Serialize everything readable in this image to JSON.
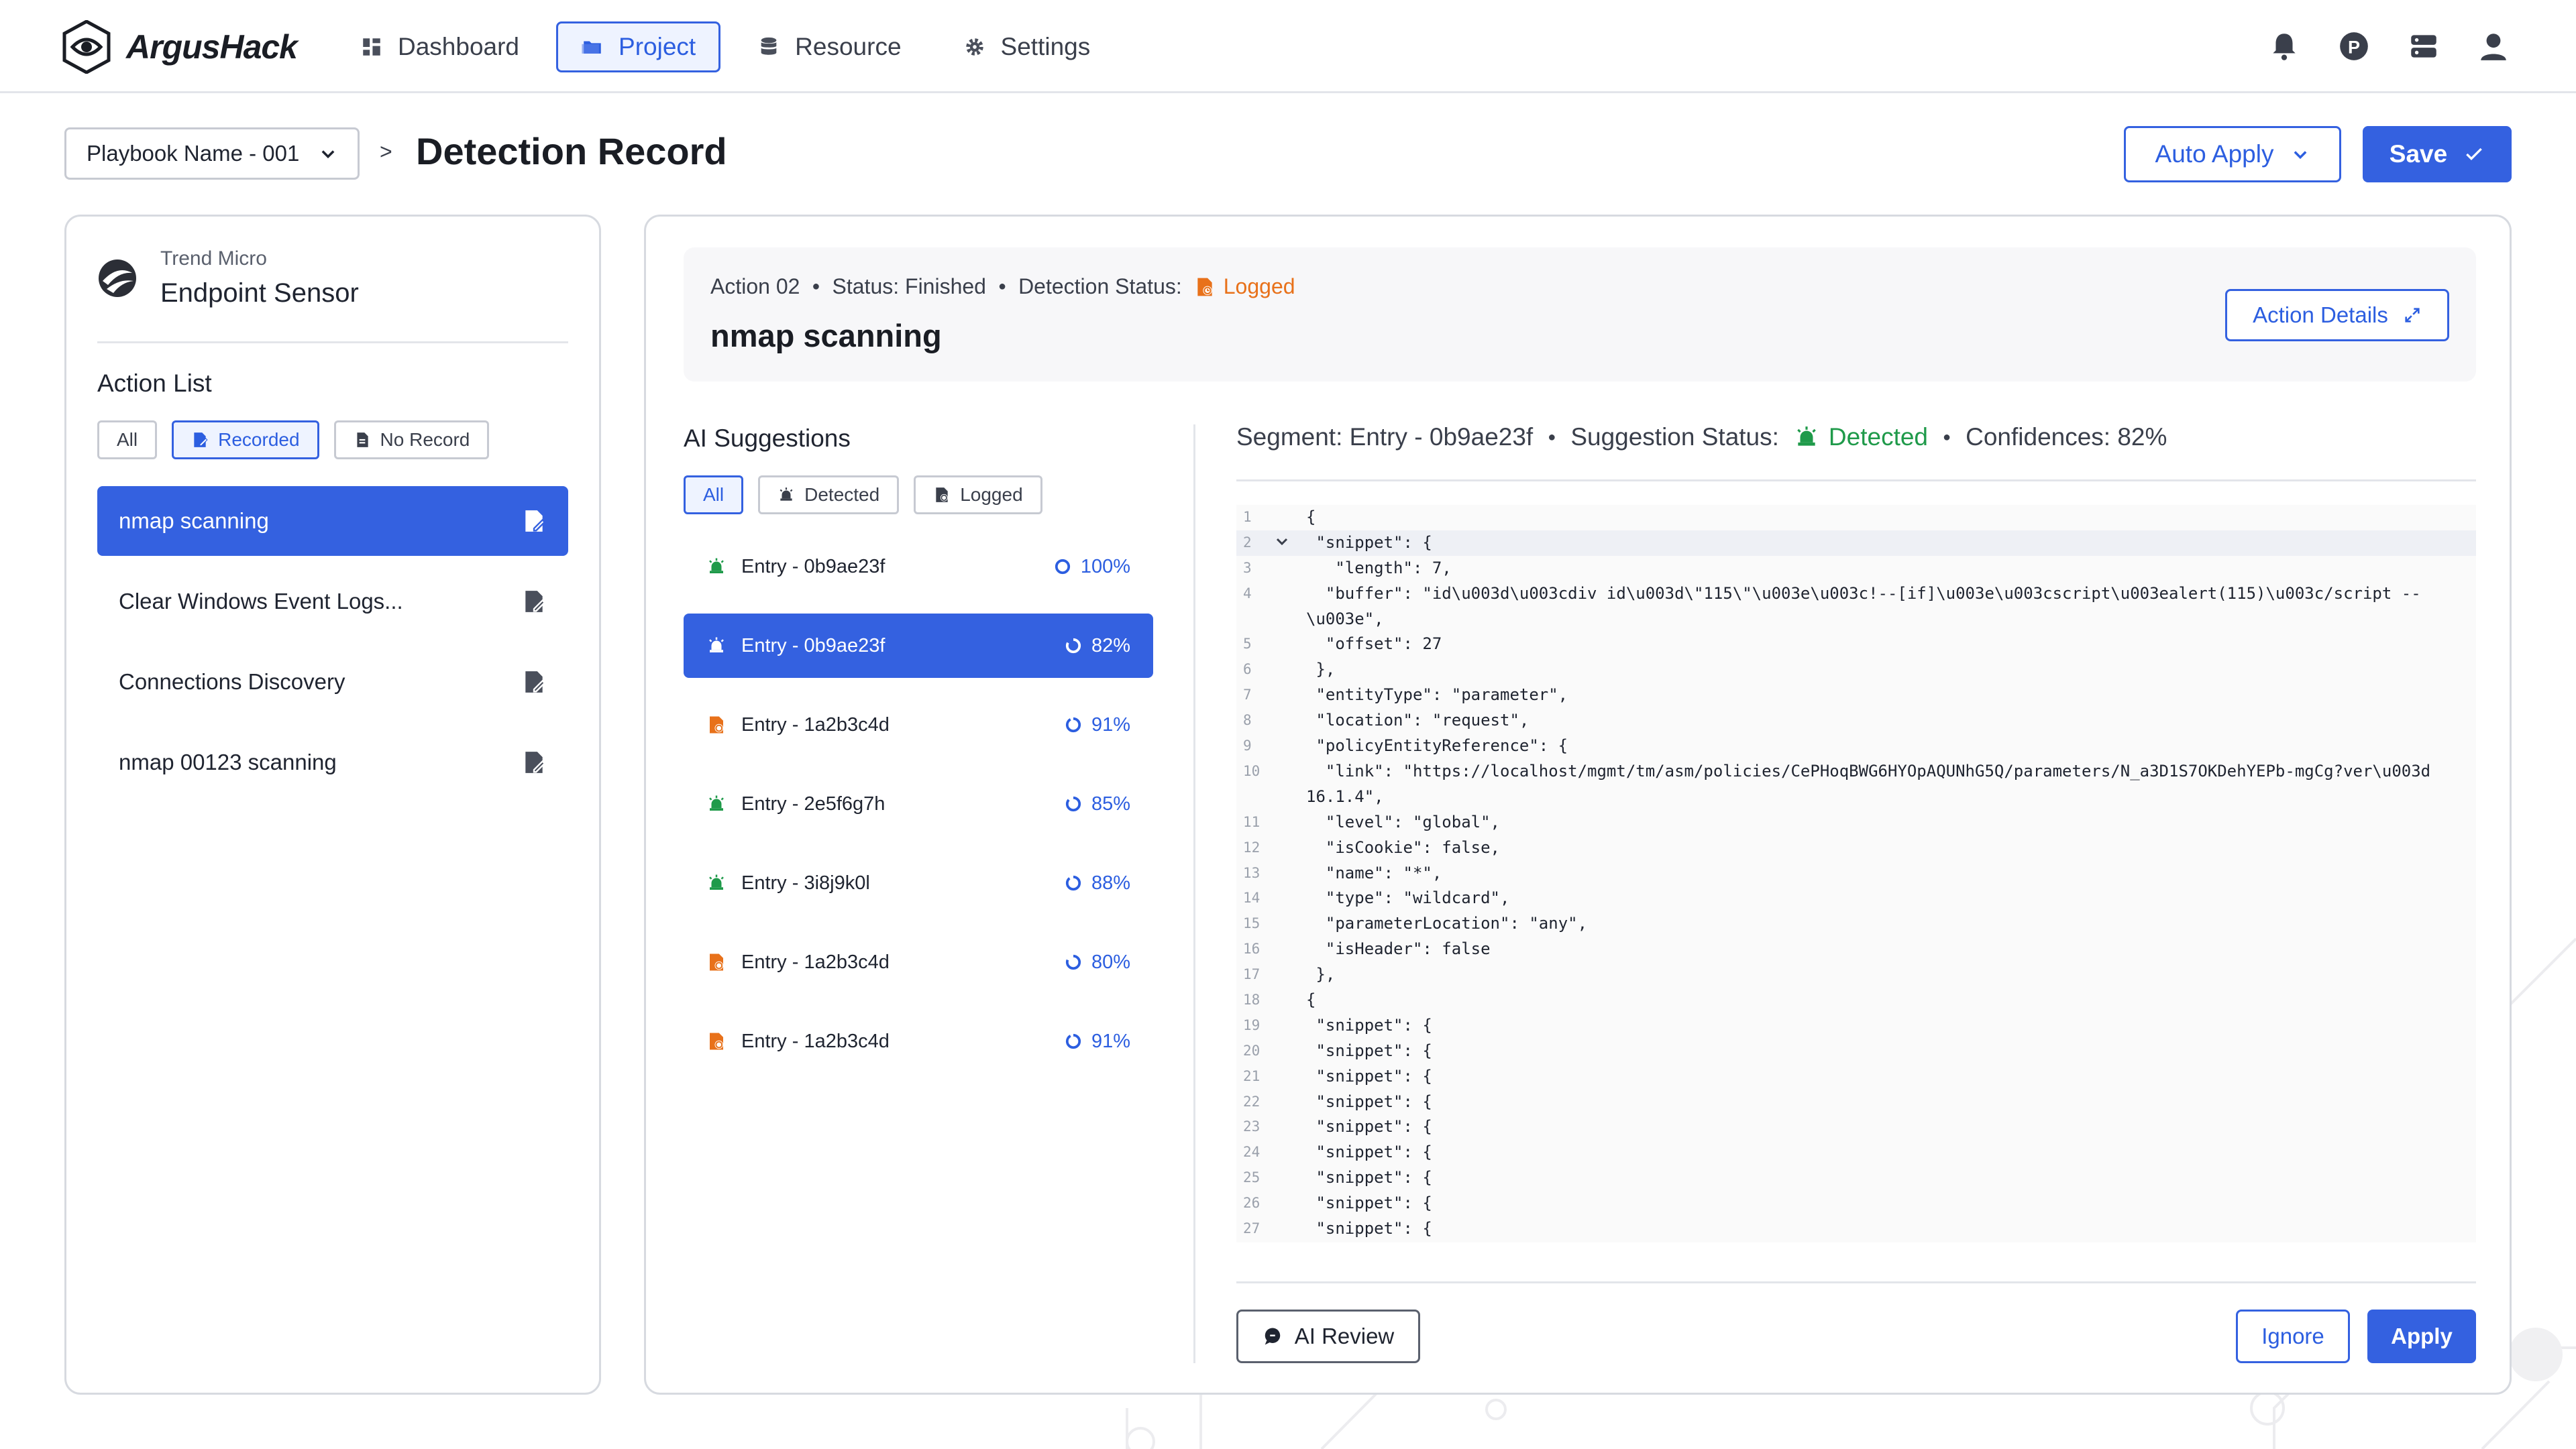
{
  "app": {
    "name": "ArgusHack"
  },
  "nav": [
    {
      "label": "Dashboard",
      "icon": "dashboard-icon"
    },
    {
      "label": "Project",
      "icon": "folder-icon",
      "active": true
    },
    {
      "label": "Resource",
      "icon": "database-icon"
    },
    {
      "label": "Settings",
      "icon": "gear-icon"
    }
  ],
  "header": {
    "playbook_select": "Playbook Name - 001",
    "separator": ">",
    "title": "Detection Record",
    "auto_apply_label": "Auto Apply",
    "save_label": "Save"
  },
  "left": {
    "vendor_sub": "Trend Micro",
    "vendor_name": "Endpoint Sensor",
    "section_title": "Action List",
    "filters": [
      "All",
      "Recorded",
      "No Record"
    ],
    "actions": [
      {
        "label": "nmap scanning",
        "active": true
      },
      {
        "label": "Clear Windows Event Logs..."
      },
      {
        "label": "Connections Discovery"
      },
      {
        "label": "nmap 00123 scanning"
      }
    ]
  },
  "action": {
    "number": "Action 02",
    "status": "Status: Finished",
    "detection_label": "Detection Status:",
    "detection_value": "Logged",
    "title": "nmap scanning",
    "details_label": "Action Details"
  },
  "suggestions": {
    "title": "AI Suggestions",
    "filters": [
      "All",
      "Detected",
      "Logged"
    ],
    "items": [
      {
        "label": "Entry - 0b9ae23f",
        "confidence": "100%",
        "type": "detected"
      },
      {
        "label": "Entry - 0b9ae23f",
        "confidence": "82%",
        "type": "detected",
        "active": true
      },
      {
        "label": "Entry - 1a2b3c4d",
        "confidence": "91%",
        "type": "logged"
      },
      {
        "label": "Entry - 2e5f6g7h",
        "confidence": "85%",
        "type": "detected"
      },
      {
        "label": "Entry - 3i8j9k0l",
        "confidence": "88%",
        "type": "detected"
      },
      {
        "label": "Entry - 1a2b3c4d",
        "confidence": "80%",
        "type": "logged"
      },
      {
        "label": "Entry - 1a2b3c4d",
        "confidence": "91%",
        "type": "logged"
      }
    ]
  },
  "segment": {
    "segment_label": "Segment: Entry - 0b9ae23f",
    "status_label": "Suggestion Status:",
    "status_value": "Detected",
    "confidence_label": "Confidences: 82%"
  },
  "code": [
    {
      "n": "1",
      "t": "{"
    },
    {
      "n": "2",
      "t": " \"snippet\": {",
      "fold": true,
      "hl": true
    },
    {
      "n": "3",
      "t": "   \"length\": 7,"
    },
    {
      "n": "4",
      "t": "  \"buffer\": \"id\\u003d\\u003cdiv id\\u003d\\\"115\\\"\\u003e\\u003c!--[if]\\u003e\\u003cscript\\u003ealert(115)\\u003c/script --\\u003e\",",
      "wrap": true
    },
    {
      "n": "5",
      "t": "  \"offset\": 27"
    },
    {
      "n": "6",
      "t": " },"
    },
    {
      "n": "7",
      "t": " \"entityType\": \"parameter\","
    },
    {
      "n": "8",
      "t": " \"location\": \"request\","
    },
    {
      "n": "9",
      "t": " \"policyEntityReference\": {"
    },
    {
      "n": "10",
      "t": "  \"link\": \"https://localhost/mgmt/tm/asm/policies/CePHoqBWG6HYOpAQUNhG5Q/parameters/N_a3D1S7OKDehYEPb-mgCg?ver\\u003d16.1.4\",",
      "wrap": true
    },
    {
      "n": "11",
      "t": "  \"level\": \"global\","
    },
    {
      "n": "12",
      "t": "  \"isCookie\": false,"
    },
    {
      "n": "13",
      "t": "  \"name\": \"*\","
    },
    {
      "n": "14",
      "t": "  \"type\": \"wildcard\","
    },
    {
      "n": "15",
      "t": "  \"parameterLocation\": \"any\","
    },
    {
      "n": "16",
      "t": "  \"isHeader\": false"
    },
    {
      "n": "17",
      "t": " },"
    },
    {
      "n": "18",
      "t": "{"
    },
    {
      "n": "19",
      "t": " \"snippet\": {"
    },
    {
      "n": "20",
      "t": " \"snippet\": {"
    },
    {
      "n": "21",
      "t": " \"snippet\": {"
    },
    {
      "n": "22",
      "t": " \"snippet\": {"
    },
    {
      "n": "23",
      "t": " \"snippet\": {"
    },
    {
      "n": "24",
      "t": " \"snippet\": {"
    },
    {
      "n": "25",
      "t": " \"snippet\": {"
    },
    {
      "n": "26",
      "t": " \"snippet\": {"
    },
    {
      "n": "27",
      "t": " \"snippet\": {"
    }
  ],
  "footer": {
    "ai_review_label": "AI Review",
    "ignore_label": "Ignore",
    "apply_label": "Apply"
  },
  "colors": {
    "primary": "#3461e0",
    "detected": "#1f9a4a",
    "logged": "#e8711a"
  }
}
